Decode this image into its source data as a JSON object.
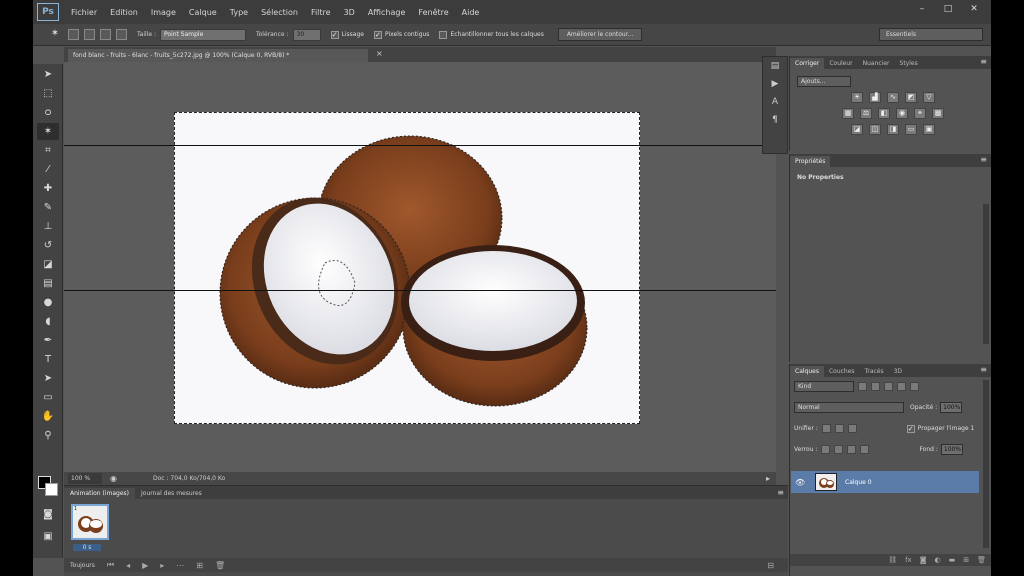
{
  "menu": {
    "logo": "Ps",
    "items": [
      "Fichier",
      "Edition",
      "Image",
      "Calque",
      "Type",
      "Sélection",
      "Filtre",
      "3D",
      "Affichage",
      "Fenêtre",
      "Aide"
    ]
  },
  "window_controls": {
    "minimize": "–",
    "maximize": "□",
    "close": "✕"
  },
  "options": {
    "size_label": "Taille :",
    "size_value": "Point Sample",
    "tolerance_label": "Tolérance :",
    "tolerance_value": "30",
    "lissage": "Lissage",
    "pixels_contigus": "Pixels contigus",
    "echantillonner": "Echantillonner tous les calques",
    "ameliorer": "Améliorer le contour...",
    "workspace": "Essentiels"
  },
  "document": {
    "tab_title": "fond blanc - fruits - 6lanc - fruits_5c272.jpg @ 100% (Calque 0, RVB/8) *",
    "zoom": "100 %",
    "doc_info": "Doc : 704,0 Ko/704,0 Ko"
  },
  "timeline": {
    "tabs": [
      "Animation (images)",
      "Journal des mesures"
    ],
    "frame_number": "1",
    "frame_delay": "0 s",
    "loop": "Toujours"
  },
  "adjustments_panel": {
    "tabs": [
      "Corriger",
      "Couleur",
      "Nuancier",
      "Styles"
    ],
    "select": "Ajouts..."
  },
  "properties_panel": {
    "tab": "Propriétés",
    "content": "No Properties"
  },
  "layers_panel": {
    "tabs": [
      "Calques",
      "Couches",
      "Tracés",
      "3D"
    ],
    "kind": "Kind",
    "blend_mode": "Normal",
    "opacity_label": "Opacité :",
    "opacity_value": "100%",
    "unify_label": "Unifier :",
    "propagate_label": "Propager l'image 1",
    "lock_label": "Verrou :",
    "fill_label": "Fond :",
    "fill_value": "100%",
    "layer_name": "Calque 0"
  }
}
